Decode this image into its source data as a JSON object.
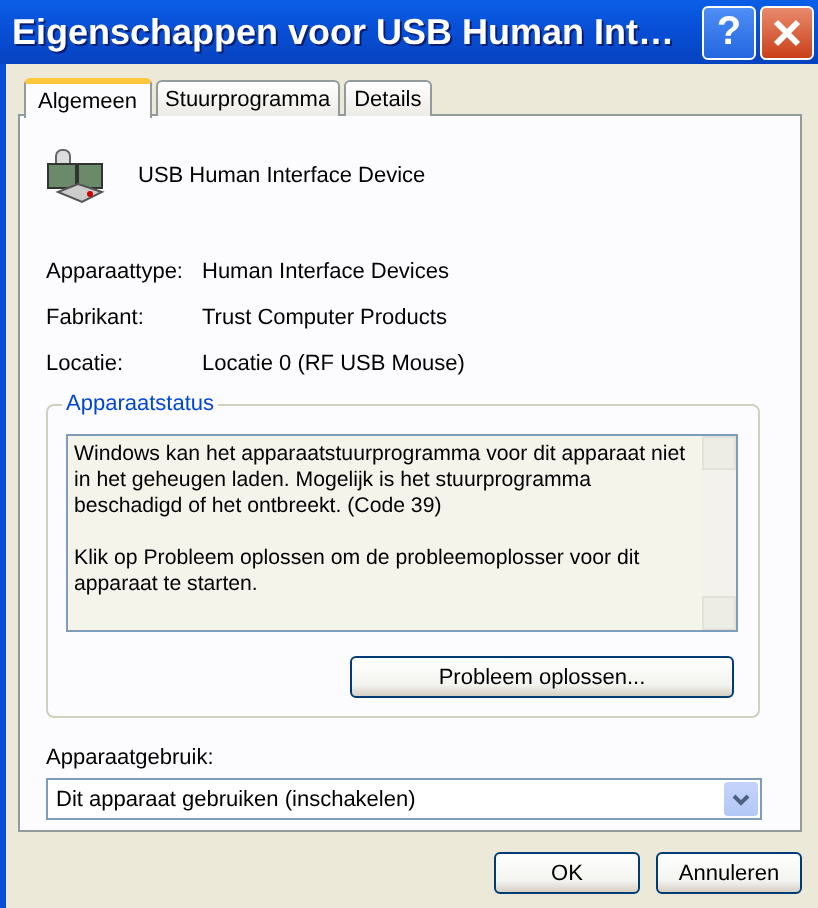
{
  "window": {
    "title": "Eigenschappen voor USB Human Int…",
    "help_button": "?"
  },
  "tabs": [
    {
      "label": "Algemeen",
      "selected": true
    },
    {
      "label": "Stuurprogramma",
      "selected": false
    },
    {
      "label": "Details",
      "selected": false
    }
  ],
  "device": {
    "name": "USB Human Interface Device"
  },
  "properties": [
    {
      "label": "Apparaattype:",
      "value": "Human Interface Devices"
    },
    {
      "label": "Fabrikant:",
      "value": "Trust Computer Products"
    },
    {
      "label": "Locatie:",
      "value": "Locatie 0 (RF USB Mouse)"
    }
  ],
  "status": {
    "title": "Apparaatstatus",
    "paragraphs": [
      "Windows kan het apparaatstuurprogramma voor dit apparaat niet in het geheugen laden. Mogelijk is het stuurprogramma beschadigd of het ontbreekt. (Code 39)",
      "Klik op Probleem oplossen om de probleemoplosser voor dit apparaat te starten."
    ],
    "button": "Probleem oplossen..."
  },
  "usage": {
    "label": "Apparaatgebruik:",
    "value": "Dit apparaat gebruiken (inschakelen)"
  },
  "buttons": [
    "OK",
    "Annuleren"
  ]
}
